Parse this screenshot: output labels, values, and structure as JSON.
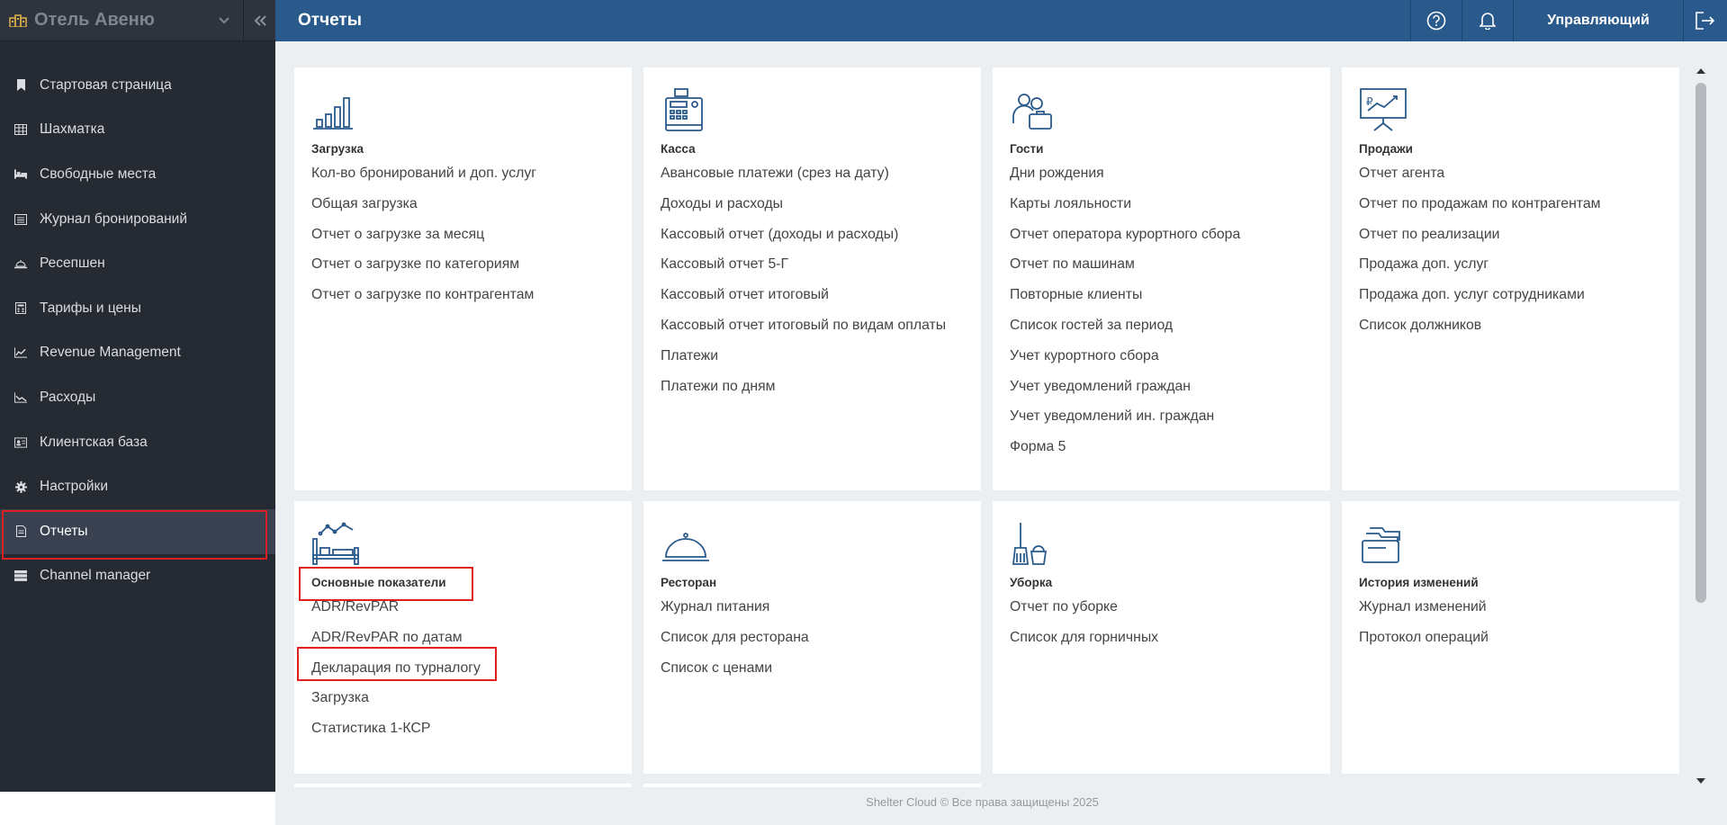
{
  "sidebar": {
    "hotel_name": "Отель Авеню",
    "items": [
      {
        "label": "Стартовая страница",
        "icon": "bookmark-icon"
      },
      {
        "label": "Шахматка",
        "icon": "grid-icon"
      },
      {
        "label": "Свободные места",
        "icon": "bed-icon"
      },
      {
        "label": "Журнал бронирований",
        "icon": "journal-icon"
      },
      {
        "label": "Ресепшен",
        "icon": "bell-desk-icon"
      },
      {
        "label": "Тарифы и цены",
        "icon": "calculator-icon"
      },
      {
        "label": "Revenue Management",
        "icon": "line-chart-icon"
      },
      {
        "label": "Расходы",
        "icon": "area-chart-icon"
      },
      {
        "label": "Клиентская база",
        "icon": "id-card-icon"
      },
      {
        "label": "Настройки",
        "icon": "gear-icon"
      },
      {
        "label": "Отчеты",
        "icon": "document-icon",
        "active": true
      },
      {
        "label": "Channel manager",
        "icon": "server-icon"
      }
    ]
  },
  "header": {
    "title": "Отчеты",
    "user": "Управляющий"
  },
  "cards": [
    {
      "title": "Загрузка",
      "icon": "bar-chart-icon",
      "links": [
        "Кол-во бронирований и доп. услуг",
        "Общая загрузка",
        "Отчет о загрузке за месяц",
        "Отчет о загрузке по категориям",
        "Отчет о загрузке по контрагентам"
      ]
    },
    {
      "title": "Касса",
      "icon": "cash-register-icon",
      "links": [
        "Авансовые платежи (срез на дату)",
        "Доходы и расходы",
        "Кассовый отчет (доходы и расходы)",
        "Кассовый отчет 5-Г",
        "Кассовый отчет итоговый",
        "Кассовый отчет итоговый по видам оплаты",
        "Платежи",
        "Платежи по дням"
      ]
    },
    {
      "title": "Гости",
      "icon": "guests-icon",
      "links": [
        "Дни рождения",
        "Карты лояльности",
        "Отчет оператора курортного сбора",
        "Отчет по машинам",
        "Повторные клиенты",
        "Список гостей за период",
        "Учет курортного сбора",
        "Учет уведомлений граждан",
        "Учет уведомлений ин. граждан",
        "Форма 5"
      ]
    },
    {
      "title": "Продажи",
      "icon": "presentation-icon",
      "links": [
        "Отчет агента",
        "Отчет по продажам по контрагентам",
        "Отчет по реализации",
        "Продажа доп. услуг",
        "Продажа доп. услуг сотрудниками",
        "Список должников"
      ]
    },
    {
      "title": "Основные показатели",
      "icon": "kpi-bed-icon",
      "links": [
        "ADR/RevPAR",
        "ADR/RevPAR по датам",
        "Декларация по турналогу",
        "Загрузка",
        "Статистика 1-КСР"
      ]
    },
    {
      "title": "Ресторан",
      "icon": "cloche-icon",
      "links": [
        "Журнал питания",
        "Список для ресторана",
        "Список с ценами"
      ]
    },
    {
      "title": "Уборка",
      "icon": "cleaning-icon",
      "links": [
        "Отчет по уборке",
        "Список для горничных"
      ]
    },
    {
      "title": "История изменений",
      "icon": "folders-icon",
      "links": [
        "Журнал изменений",
        "Протокол операций"
      ]
    }
  ],
  "footer": "Shelter Cloud © Все права защищены 2025"
}
